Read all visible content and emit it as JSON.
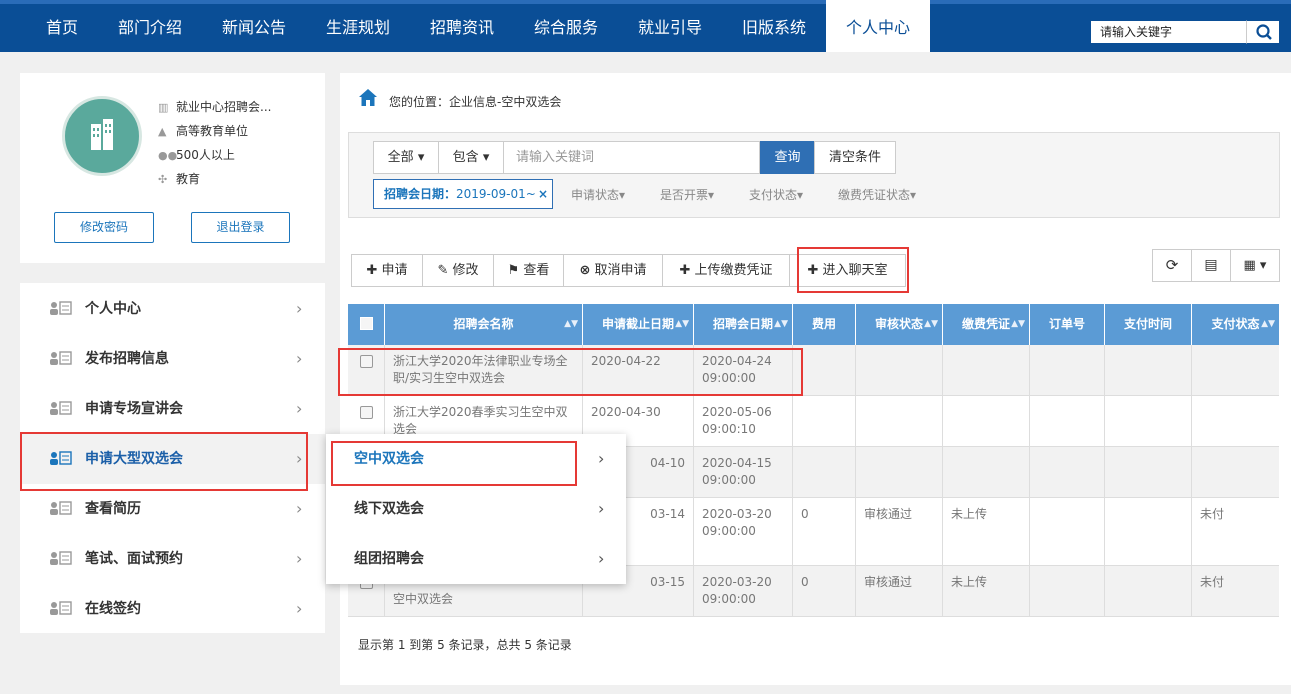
{
  "nav": {
    "items": [
      "首页",
      "部门介绍",
      "新闻公告",
      "生涯规划",
      "招聘资讯",
      "综合服务",
      "就业引导",
      "旧版系统",
      "个人中心"
    ],
    "active_index": 8,
    "search_placeholder": "请输入关键字"
  },
  "profile": {
    "info": [
      "就业中心招聘会...",
      "高等教育单位",
      "500人以上",
      "教育"
    ],
    "change_password": "修改密码",
    "logout": "退出登录"
  },
  "sidebar": {
    "items": [
      "个人中心",
      "发布招聘信息",
      "申请专场宣讲会",
      "申请大型双选会",
      "查看简历",
      "笔试、面试预约",
      "在线签约"
    ],
    "active_index": 3
  },
  "submenu": {
    "items": [
      "空中双选会",
      "线下双选会",
      "组团招聘会"
    ],
    "active_index": 0
  },
  "breadcrumb": "您的位置：企业信息-空中双选会",
  "filter": {
    "scope": "全部",
    "match": "包含",
    "keyword_placeholder": "请输入关键词",
    "query": "查询",
    "clear": "清空条件",
    "date_tag_label": "招聘会日期：",
    "date_tag_value": "2019-09-01~",
    "statuses": [
      "申请状态",
      "是否开票",
      "支付状态",
      "缴费凭证状态"
    ]
  },
  "actions": [
    "申请",
    "修改",
    "查看",
    "取消申请",
    "上传缴费凭证",
    "进入聊天室"
  ],
  "table": {
    "headers": [
      "招聘会名称",
      "申请截止日期",
      "招聘会日期",
      "费用",
      "审核状态",
      "缴费凭证",
      "订单号",
      "支付时间",
      "支付状态"
    ],
    "rows": [
      {
        "name": "浙江大学2020年法律职业专场全职/实习生空中双选会",
        "deadline": "2020-04-22",
        "date": "2020-04-24 09:00:00",
        "fee": "",
        "audit": "",
        "voucher": "",
        "order": "",
        "paytime": "",
        "paystatus": ""
      },
      {
        "name": "浙江大学2020春季实习生空中双选会",
        "deadline": "2020-04-30",
        "date": "2020-05-06 09:00:10",
        "fee": "",
        "audit": "",
        "voucher": "",
        "order": "",
        "paytime": "",
        "paystatus": ""
      },
      {
        "name": "",
        "deadline": "04-10",
        "date": "2020-04-15 09:00:00",
        "fee": "",
        "audit": "",
        "voucher": "",
        "order": "",
        "paytime": "",
        "paystatus": ""
      },
      {
        "name": "",
        "deadline": "03-14",
        "date": "2020-03-20 09:00:00",
        "fee": "0",
        "audit": "审核通过",
        "voucher": "未上传",
        "order": "",
        "paytime": "",
        "paystatus": "未付"
      },
      {
        "name": "空中双选会",
        "deadline": "03-15",
        "date": "2020-03-20 09:00:00",
        "fee": "0",
        "audit": "审核通过",
        "voucher": "未上传",
        "order": "",
        "paytime": "",
        "paystatus": "未付"
      }
    ]
  },
  "pager": "显示第 1 到第 5 条记录，总共 5 条记录",
  "colors": {
    "nav_bg": "#0a4e96",
    "header_bg": "#5b9bd5",
    "accent": "#1b75bb",
    "highlight": "#e53935"
  }
}
